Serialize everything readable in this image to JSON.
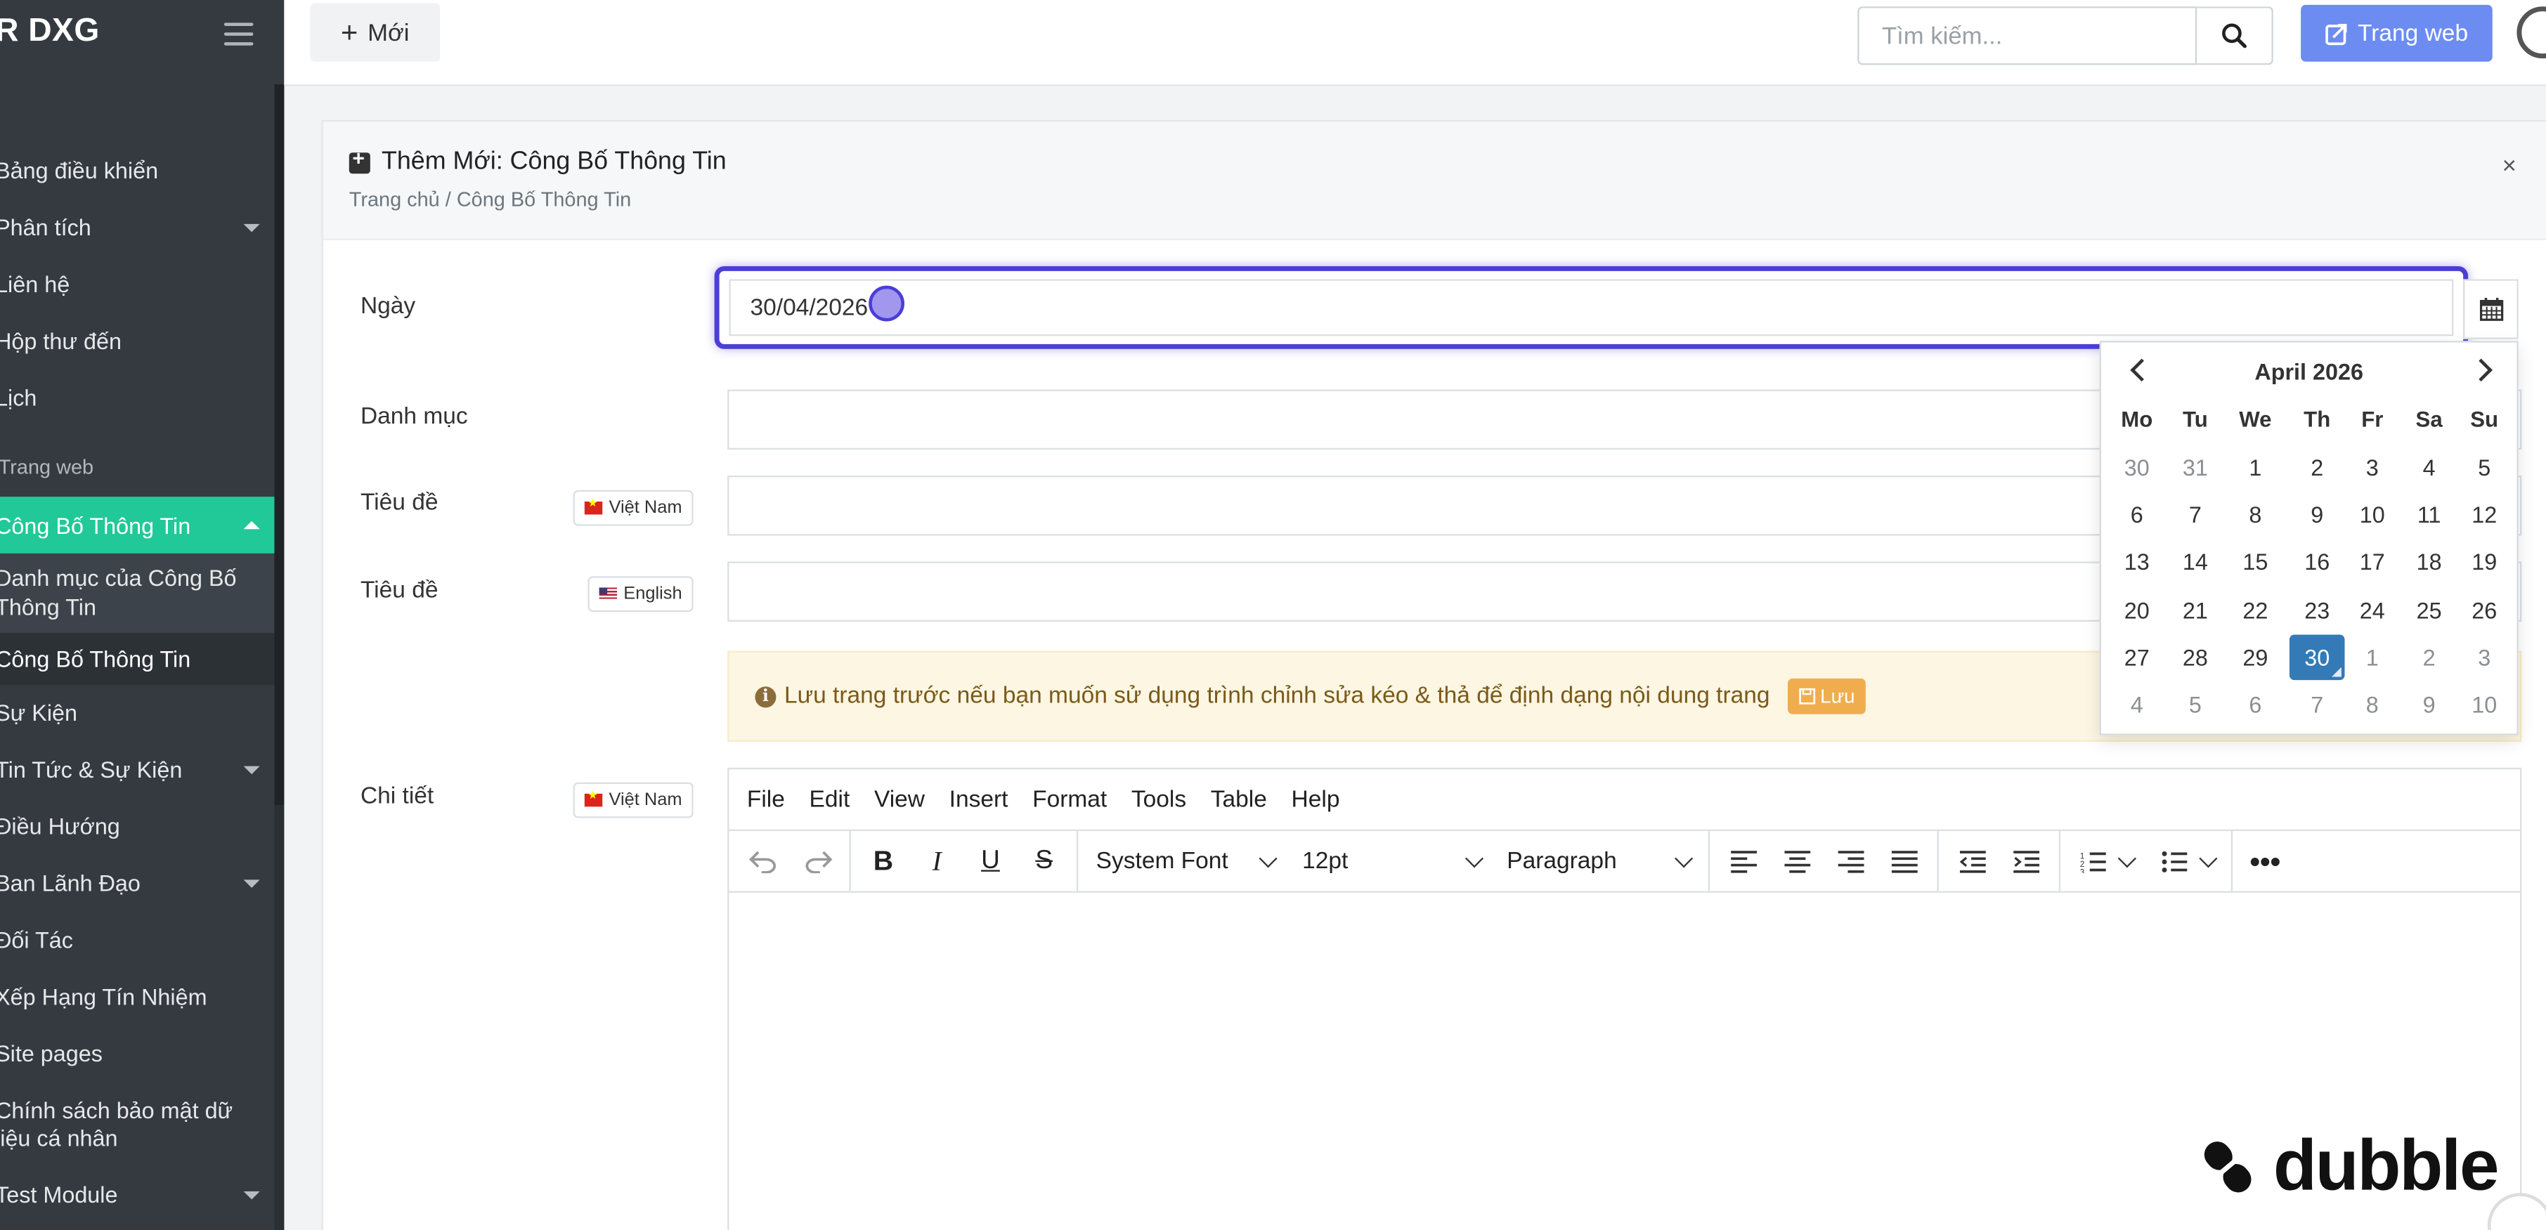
{
  "sidebar": {
    "brand": "R DXG",
    "items": [
      {
        "label": "Bảng điều khiển"
      },
      {
        "label": "Phân tích"
      },
      {
        "label": "Liên hệ"
      },
      {
        "label": "Hộp thư đến"
      },
      {
        "label": "Lịch"
      }
    ],
    "section_header": "Trang web",
    "active": "Công Bố Thông Tin",
    "sub_items": [
      "Danh mục của Công Bố",
      "Thông Tin",
      "Công Bố Thông Tin"
    ],
    "items2": [
      {
        "label": "Sự Kiện"
      },
      {
        "label": "Tin Tức & Sự Kiện"
      },
      {
        "label": "Điều Hướng"
      },
      {
        "label": "Ban Lãnh Đạo"
      },
      {
        "label": "Đối Tác"
      },
      {
        "label": "Xếp Hạng Tín Nhiệm"
      },
      {
        "label": "Site pages"
      },
      {
        "label": "Chính sách bảo mật dữ",
        "line2": "liệu cá nhân"
      },
      {
        "label": "Test Module"
      }
    ]
  },
  "topbar": {
    "new_label": "Mới",
    "search_placeholder": "Tìm kiếm...",
    "web_label": "Trang web"
  },
  "card": {
    "title": "Thêm Mới: Công Bố Thông Tin",
    "breadcrumb": "Trang chủ / Công Bố Thông Tin",
    "close": "×"
  },
  "form": {
    "date_label": "Ngày",
    "date_value": "30/04/2026",
    "category_label": "Danh mục",
    "title_label": "Tiêu đề",
    "lang_vn": "Việt Nam",
    "lang_en": "English",
    "notice": "Lưu trang trước nếu bạn muốn sử dụng trình chỉnh sửa kéo & thả để định dạng nội dung trang",
    "notice_save": "Lưu",
    "detail_label": "Chi tiết"
  },
  "editor": {
    "menu": [
      "File",
      "Edit",
      "View",
      "Insert",
      "Format",
      "Tools",
      "Table",
      "Help"
    ],
    "font": "System Font",
    "size": "12pt",
    "block": "Paragraph"
  },
  "datepicker": {
    "month": "April 2026",
    "dow": [
      "Mo",
      "Tu",
      "We",
      "Th",
      "Fr",
      "Sa",
      "Su"
    ],
    "weeks": [
      [
        "30",
        "31",
        "1",
        "2",
        "3",
        "4",
        "5"
      ],
      [
        "6",
        "7",
        "8",
        "9",
        "10",
        "11",
        "12"
      ],
      [
        "13",
        "14",
        "15",
        "16",
        "17",
        "18",
        "19"
      ],
      [
        "20",
        "21",
        "22",
        "23",
        "24",
        "25",
        "26"
      ],
      [
        "27",
        "28",
        "29",
        "30",
        "1",
        "2",
        "3"
      ],
      [
        "4",
        "5",
        "6",
        "7",
        "8",
        "9",
        "10"
      ]
    ],
    "selected": "30"
  },
  "watermark": "dubble",
  "colors": {
    "sidebar": "#343a40",
    "active": "#20c997",
    "accent": "#4b3ed6",
    "primary": "#337ab7"
  }
}
